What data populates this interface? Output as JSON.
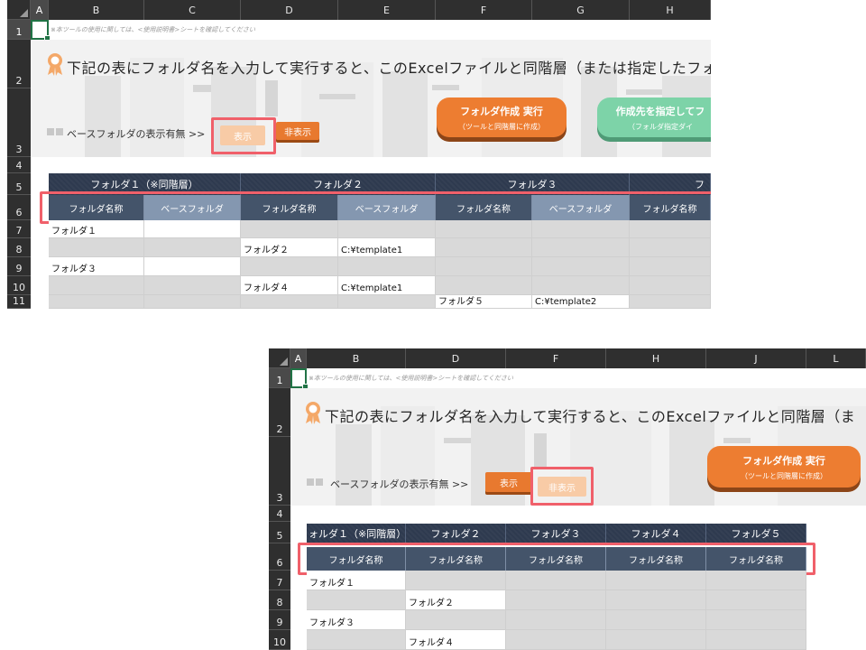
{
  "note": "※本ツールの使用に関しては、<使用説明書>シートを確認してください",
  "banner_title": "下記の表にフォルダ名を入力して実行すると、このExcelファイルと同階層（または指定したフォル",
  "banner_title2": "下記の表にフォルダ名を入力して実行すると、このExcelファイルと同階層（ま",
  "base_label": "ベースフォルダの表示有無 >>",
  "show_label": "表示",
  "hide_label": "非表示",
  "run_button": {
    "line1": "フォルダ作成 実行",
    "line2": "（ツールと同階層に作成）"
  },
  "run_button2": {
    "line1": "作成先を指定してフ",
    "line2": "（フォルダ指定ダイ"
  },
  "shot1": {
    "columns": [
      "A",
      "B",
      "C",
      "D",
      "E",
      "F",
      "G",
      "H"
    ],
    "rows": [
      "1",
      "2",
      "3",
      "4",
      "5",
      "6",
      "7",
      "8",
      "9",
      "10",
      "11"
    ],
    "groups": [
      "フォルダ１（※同階層）",
      "フォルダ２",
      "フォルダ３",
      "フ"
    ],
    "sub": [
      "フォルダ名称",
      "ベースフォルダ",
      "フォルダ名称",
      "ベースフォルダ",
      "フォルダ名称",
      "ベースフォルダ",
      "フォルダ名称"
    ],
    "r7": "フォルダ１",
    "r8": [
      "フォルダ２",
      "C:¥template1"
    ],
    "r9": "フォルダ３",
    "r10": [
      "フォルダ４",
      "C:¥template1"
    ],
    "r11": [
      "フォルダ５",
      "C:¥template2"
    ]
  },
  "shot2": {
    "columns": [
      "A",
      "B",
      "D",
      "F",
      "H",
      "J",
      "L"
    ],
    "rows": [
      "1",
      "2",
      "3",
      "4",
      "5",
      "6",
      "7",
      "8",
      "9",
      "10"
    ],
    "groups": [
      "ォルダ１（※同階層）",
      "フォルダ２",
      "フォルダ３",
      "フォルダ４",
      "フォルダ５"
    ],
    "sub": [
      "フォルダ名称",
      "フォルダ名称",
      "フォルダ名称",
      "フォルダ名称",
      "フォルダ名称"
    ],
    "r7": "フォルダ１",
    "r8": "フォルダ２",
    "r9": "フォルダ３",
    "r10": "フォルダ４"
  }
}
